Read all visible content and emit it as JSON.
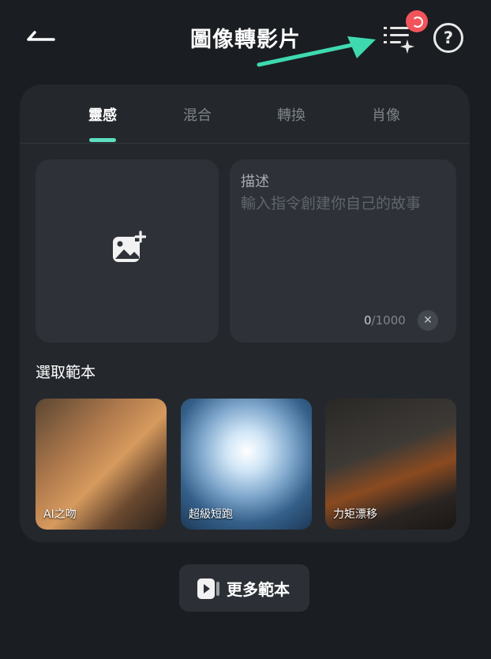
{
  "header": {
    "title": "圖像轉影片"
  },
  "tabs": [
    {
      "label": "靈感"
    },
    {
      "label": "混合"
    },
    {
      "label": "轉換"
    },
    {
      "label": "肖像"
    }
  ],
  "description": {
    "label": "描述",
    "placeholder": "輸入指令創建你自己的故事",
    "count": "0",
    "max": "/1000"
  },
  "templates": {
    "section_title": "選取範本",
    "items": [
      {
        "label": "AI之吻"
      },
      {
        "label": "超級短跑"
      },
      {
        "label": "力矩漂移"
      }
    ]
  },
  "more_button": {
    "label": "更多範本"
  },
  "colors": {
    "accent": "#5ce0c0",
    "notification": "#f2545b",
    "background": "#1a1d21",
    "card": "#24282d"
  }
}
